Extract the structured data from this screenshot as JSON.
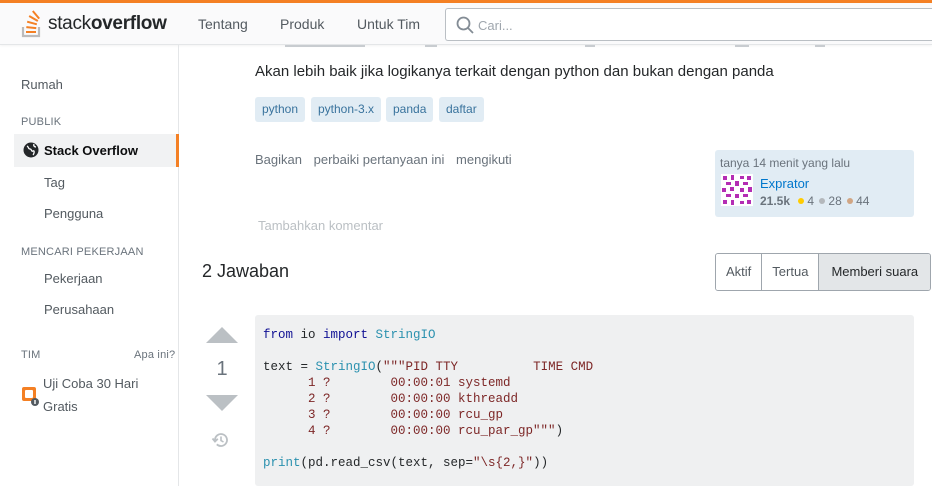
{
  "header": {
    "logo_text_light": "stack",
    "logo_text_bold": "overflow",
    "nav": [
      "Tentang",
      "Produk",
      "Untuk Tim"
    ],
    "search_placeholder": "Cari..."
  },
  "sidebar": {
    "home": "Rumah",
    "public_heading": "PUBLIK",
    "active_item": "Stack Overflow",
    "tags": "Tag",
    "users": "Pengguna",
    "jobs_heading": "MENCARI PEKERJAAN",
    "jobs": "Pekerjaan",
    "companies": "Perusahaan",
    "teams_heading": "TIM",
    "teams_help": "Apa ini?",
    "trial_line1": "Uji Coba 30 Hari",
    "trial_line2": "Gratis"
  },
  "question": {
    "lead": "Akan lebih baik jika logikanya terkait dengan python dan bukan dengan panda",
    "tags": [
      "python",
      "python-3.x",
      "panda",
      "daftar"
    ],
    "menu": [
      "Bagikan",
      "perbaiki pertanyaan ini",
      "mengikuti"
    ],
    "add_comment": "Tambahkan komentar"
  },
  "owner": {
    "asked": "tanya 14 menit yang lalu",
    "name": "Exprator",
    "reputation": "21.5k",
    "gold": "4",
    "silver": "28",
    "bronze": "44"
  },
  "answers": {
    "title": "2 Jawaban",
    "sort": [
      "Aktif",
      "Tertua",
      "Memberi suara"
    ],
    "selected_sort": "Memberi suara"
  },
  "answer": {
    "votes": "1",
    "code": {
      "l1_kw1": "from",
      "l1_mod": " io ",
      "l1_kw2": "import",
      "l1_cls": " StringIO",
      "l3_a": "text = ",
      "l3_cls": "StringIO",
      "l3_b": "(",
      "l3_str": "\"\"\"PID TTY          TIME CMD",
      "l4": "      1 ?        00:00:01 systemd",
      "l5": "      2 ?        00:00:00 kthreadd",
      "l6": "      3 ?        00:00:00 rcu_gp",
      "l7": "      4 ?        00:00:00 rcu_par_gp\"\"\"",
      "l7_end": ")",
      "l9_a": "print",
      "l9_b": "(pd.read_csv(text, sep=",
      "l9_str": "\"\\s{2,}\"",
      "l9_c": "))"
    }
  },
  "colors": {
    "accent": "#f48024",
    "tag_bg": "#e1ecf4",
    "tag_fg": "#39739d",
    "link": "#0077cc",
    "gold": "#ffcc01",
    "silver": "#b4b8bc",
    "bronze": "#d1a684"
  }
}
